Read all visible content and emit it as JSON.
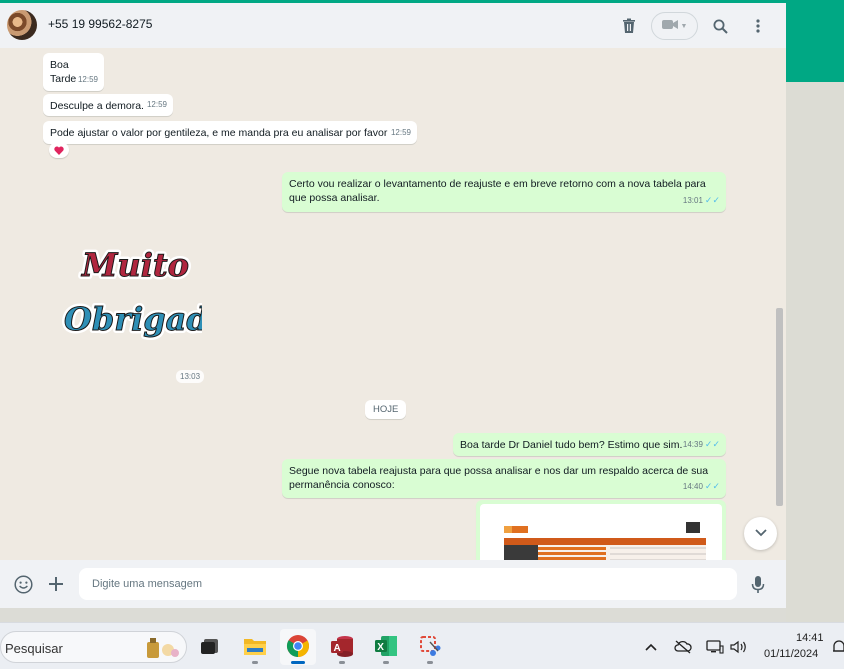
{
  "header": {
    "contact_name": "+55 19 99562-8275",
    "icons": [
      "delete-icon",
      "video-call-icon",
      "search-icon",
      "menu-icon"
    ]
  },
  "messages": [
    {
      "id": "m1",
      "dir": "in",
      "text": "Boa\nTarde",
      "time": "12:59"
    },
    {
      "id": "m2",
      "dir": "in",
      "text": "Desculpe a demora.",
      "time": "12:59"
    },
    {
      "id": "m3",
      "dir": "in",
      "text": "Pode ajustar o valor por gentileza, e me manda pra eu analisar por favor",
      "time": "12:59",
      "reaction": "❤️"
    },
    {
      "id": "m4",
      "dir": "out",
      "text": "Certo vou realizar o levantamento de reajuste e em breve retorno com a nova tabela para que possa analisar.",
      "time": "13:01",
      "status": "read"
    },
    {
      "id": "m5",
      "dir": "in",
      "type": "sticker",
      "sticker_text": [
        "Muito",
        "Obrigado"
      ],
      "time": "13:03"
    },
    {
      "id": "m6",
      "dir": "out",
      "text": "Boa tarde Dr Daniel tudo bem? Estimo que sim.",
      "time": "14:39",
      "status": "read"
    },
    {
      "id": "m7",
      "dir": "out",
      "text": "Segue nova tabela reajusta para que possa analisar e nos dar um respaldo acerca de sua permanência conosco:",
      "time": "14:40",
      "status": "read"
    },
    {
      "id": "m8",
      "dir": "out",
      "type": "image"
    }
  ],
  "day_separator": "HOJE",
  "composer": {
    "placeholder": "Digite uma mensagem",
    "icons": [
      "emoji-icon",
      "attach-plus-icon",
      "microphone-icon"
    ]
  },
  "taskbar": {
    "search_placeholder": "Pesquisar",
    "apps": [
      "task-view",
      "file-explorer",
      "chrome",
      "access",
      "excel",
      "snipping-tool"
    ],
    "active_app": "chrome",
    "clock_time": "14:41",
    "clock_date": "01/11/2024"
  },
  "colors": {
    "accent": "#00a884",
    "outgoing_bubble": "#d9fdd3",
    "incoming_bubble": "#ffffff",
    "chat_background": "#efeae2",
    "read_ticks": "#53bdeb"
  }
}
